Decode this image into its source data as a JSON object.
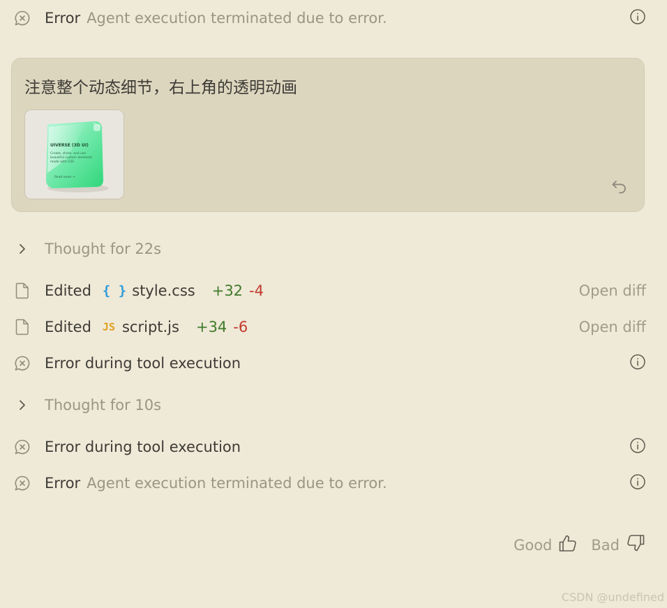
{
  "log": {
    "error_top": {
      "label": "Error",
      "detail": "Agent execution terminated due to error."
    },
    "user_message": {
      "text": "注意整个动态细节，右上角的透明动画",
      "thumbnail": {
        "title": "UIVERSE (3D UI)",
        "body": "Create, share, and use beautiful custom elements made with CSS",
        "footer": "Read more →"
      }
    },
    "thought_1": {
      "label": "Thought for 22s"
    },
    "edit_1": {
      "action": "Edited",
      "icon": "{ }",
      "file": "style.css",
      "added": "+32",
      "removed": "-4",
      "open_label": "Open diff"
    },
    "edit_2": {
      "action": "Edited",
      "icon": "JS",
      "file": "script.js",
      "added": "+34",
      "removed": "-6",
      "open_label": "Open diff"
    },
    "tool_error_1": {
      "label": "Error during tool execution"
    },
    "thought_2": {
      "label": "Thought for 10s"
    },
    "tool_error_2": {
      "label": "Error during tool execution"
    },
    "error_bottom": {
      "label": "Error",
      "detail": "Agent execution terminated due to error."
    }
  },
  "feedback": {
    "good_label": "Good",
    "bad_label": "Bad"
  },
  "watermark": "CSDN @undefined",
  "colors": {
    "background": "#efe9d7",
    "card": "#ddd6bf",
    "added": "#3f7a2a",
    "removed": "#c23a2e",
    "css_icon": "#2f9bd8",
    "js_icon": "#e0a020"
  },
  "icons": {
    "error": "chat-bubble-x-icon",
    "info": "info-circle-icon",
    "chevron": "chevron-right-icon",
    "file": "file-icon",
    "undo": "undo-arrow-icon",
    "good": "thumbs-up-icon",
    "bad": "thumbs-down-icon"
  }
}
